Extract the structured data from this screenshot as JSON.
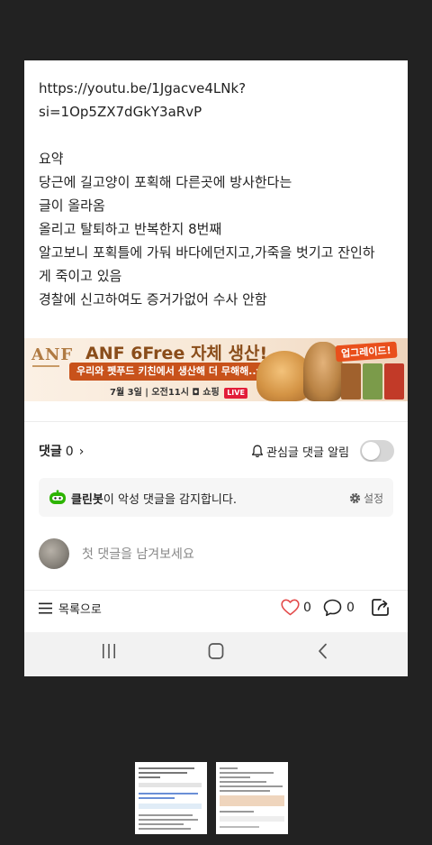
{
  "post": {
    "lines_top": [
      "https://youtu.be/1Jgacve4LNk?",
      "si=1Op5ZX7dGkY3aRvP"
    ],
    "lines_bottom": [
      "요약",
      "당근에 길고양이 포획해 다른곳에 방사한다는",
      "글이 올라옴",
      "올리고 탈퇴하고 반복한지 8번째",
      "알고보니 포획틀에 가둬 바다에던지고,가죽을 벗기고 잔인하",
      "게 죽이고 있음",
      "경찰에 신고하여도 증거가없어 수사 안함"
    ]
  },
  "ad": {
    "logo": "ANF",
    "headline": "ANF 6Free 자체 생산!",
    "subline": "우리와 펫푸드 키친에서 생산해 더 무해해..ㅠ!",
    "date": "7월 3일 | 오전11시",
    "shop": "◘ 쇼핑",
    "live": "LIVE",
    "badge": "업그레이드!"
  },
  "comments": {
    "label": "댓글",
    "count": "0",
    "alarm_label": "관심글 댓글 알림",
    "toggle_on": false,
    "cleanbot_name": "클린봇",
    "cleanbot_message": "이 악성 댓글을 감지합니다.",
    "settings_label": "설정",
    "input_placeholder": "첫 댓글을 남겨보세요"
  },
  "footer": {
    "list_label": "목록으로",
    "like_count": "0",
    "comment_count": "0"
  },
  "colors": {
    "background": "#222222",
    "heart": "#e34b4b",
    "cleanbot_green": "#2db400",
    "ad_accent": "#c8521b"
  },
  "icons": {
    "chevron": "chevron-right-icon",
    "bell": "bell-icon",
    "robot": "cleanbot-icon",
    "gear": "gear-icon",
    "menu": "menu-icon",
    "heart": "heart-icon",
    "comment": "comment-bubble-icon",
    "share": "share-icon",
    "nav_recent": "recent-apps-icon",
    "nav_home": "home-icon",
    "nav_back": "back-icon"
  }
}
